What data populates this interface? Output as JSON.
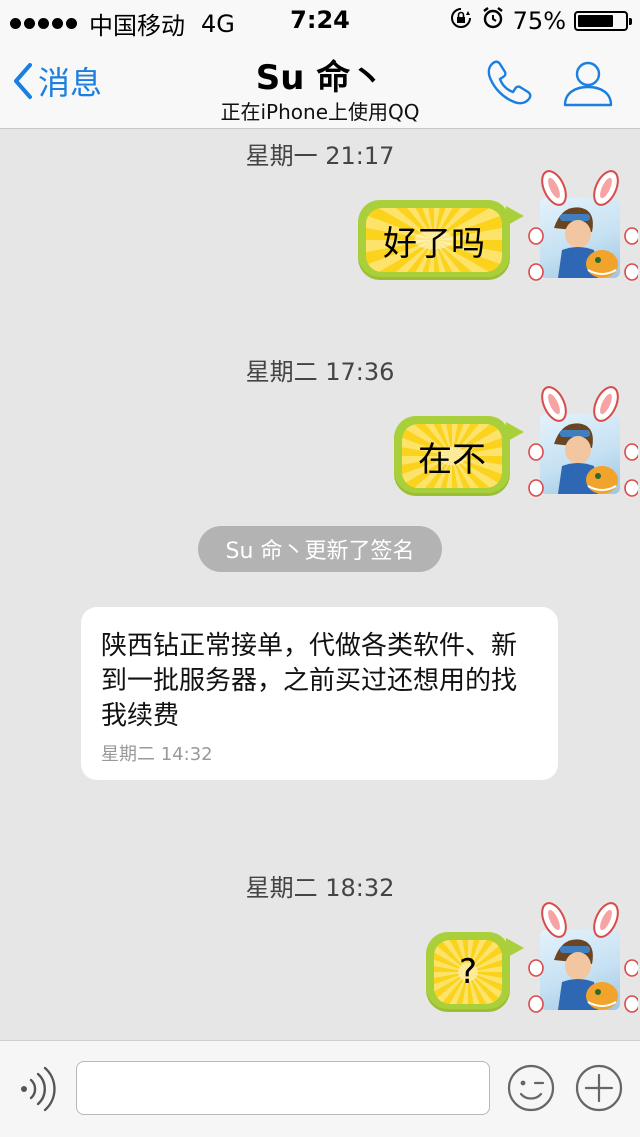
{
  "status_bar": {
    "carrier": "中国移动",
    "network": "4G",
    "time": "7:24",
    "battery_percent": "75%",
    "battery_level": 0.75
  },
  "nav": {
    "back_label": "消息",
    "title": "Su 命丶",
    "subtitle": "正在iPhone上使用QQ",
    "accent_color": "#1a7fe0"
  },
  "messages": [
    {
      "type": "timestamp",
      "text": "星期一 21:17"
    },
    {
      "type": "sent",
      "text": "好了吗"
    },
    {
      "type": "timestamp",
      "text": "星期二 17:36"
    },
    {
      "type": "sent",
      "text": "在不"
    },
    {
      "type": "system",
      "text": "Su 命丶更新了签名"
    },
    {
      "type": "received",
      "text": "陕西钻正常接单，代做各类软件、新到一批服务器，之前买过还想用的找我续费",
      "time": "星期二 14:32"
    },
    {
      "type": "timestamp",
      "text": "星期二 18:32"
    },
    {
      "type": "sent",
      "text": "?"
    }
  ],
  "input": {
    "placeholder": ""
  },
  "icons": [
    "chevron-left-icon",
    "phone-icon",
    "person-icon",
    "voice-icon",
    "emoji-icon",
    "plus-icon",
    "lock-rotation-icon",
    "alarm-icon"
  ]
}
